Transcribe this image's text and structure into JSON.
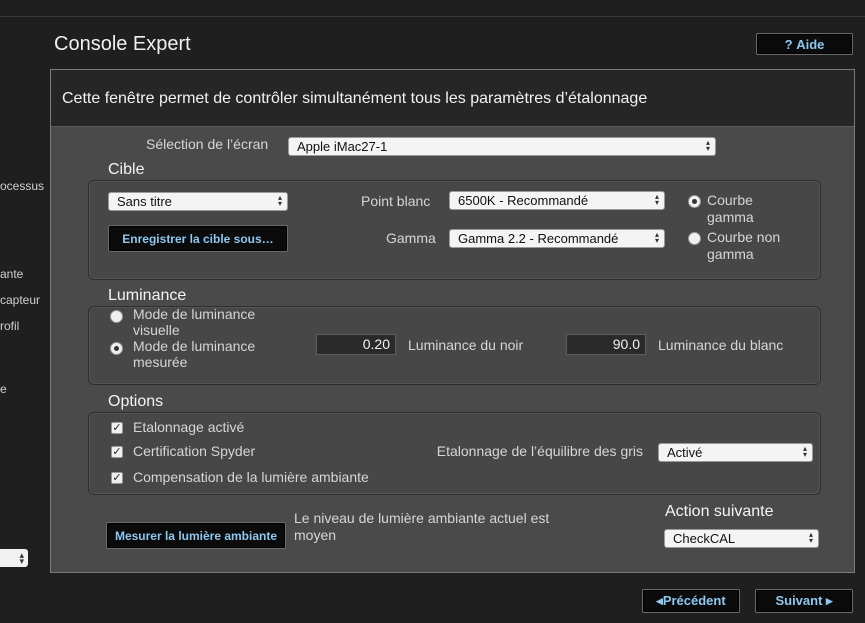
{
  "left_partial": {
    "items": [
      "ocessus",
      "ante",
      " capteur",
      "rofil",
      "e"
    ],
    "select_arrows": "▴▾"
  },
  "header": {
    "title": "Console Expert",
    "help_icon": "?",
    "help_label": "Aide"
  },
  "panel": {
    "description": "Cette fenêtre permet de contrôler simultanément tous les paramètres d’étalonnage"
  },
  "screen_selection": {
    "label": "Sélection de l’écran",
    "value": "Apple iMac27-1"
  },
  "cible": {
    "section_label": "Cible",
    "preset_value": "Sans titre",
    "save_button": "Enregistrer la cible sous…",
    "white_point_label": "Point blanc",
    "white_point_value": "6500K - Recommandé",
    "gamma_label": "Gamma",
    "gamma_value": "Gamma 2.2 - Recommandé",
    "curve_gamma_label": "Courbe gamma",
    "curve_non_gamma_label": "Courbe non gamma",
    "selected_curve": "gamma"
  },
  "luminance": {
    "section_label": "Luminance",
    "mode_visual_label": "Mode de luminance visuelle",
    "mode_measured_label": "Mode de luminance mesurée",
    "selected_mode": "measured",
    "black_value": "0.20",
    "black_label": "Luminance du noir",
    "white_value": "90.0",
    "white_label": "Luminance du blanc"
  },
  "options": {
    "section_label": "Options",
    "items": [
      {
        "label": "Etalonnage activé",
        "checked": true
      },
      {
        "label": "Certification Spyder",
        "checked": true
      },
      {
        "label": "Compensation de la lumière ambiante",
        "checked": true
      }
    ],
    "gray_balance_label": "Etalonnage de l’équilibre des gris",
    "gray_balance_value": "Activé"
  },
  "ambient": {
    "button": "Mesurer la lumière ambiante",
    "status": "Le niveau de lumière ambiante actuel est moyen"
  },
  "next_action": {
    "label": "Action suivante",
    "value": "CheckCAL"
  },
  "footer": {
    "prev_label": "◂Précédent",
    "next_label": "Suivant ▸"
  },
  "colors": {
    "background": "#1f1f1f",
    "panel": "#4a4a4a",
    "button_text": "#8ec7ef"
  }
}
